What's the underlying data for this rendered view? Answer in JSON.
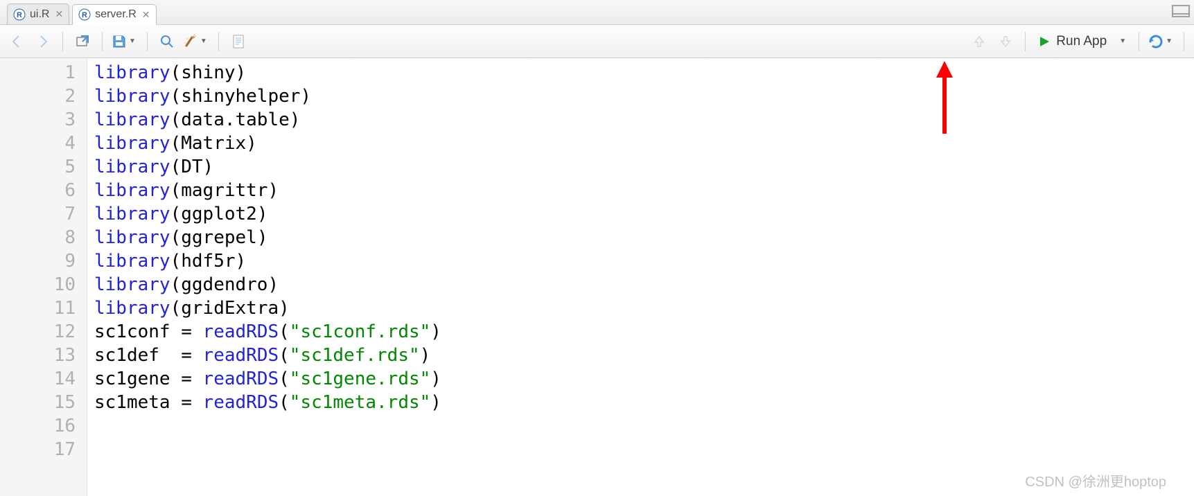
{
  "tabs": [
    {
      "label": "ui.R",
      "active": false
    },
    {
      "label": "server.R",
      "active": true
    }
  ],
  "toolbar": {
    "run_app_label": "Run App"
  },
  "code_lines": [
    {
      "n": "1",
      "tokens": [
        {
          "t": "library",
          "c": "call"
        },
        {
          "t": "(",
          "c": "punc"
        },
        {
          "t": "shiny",
          "c": "def"
        },
        {
          "t": ")",
          "c": "punc"
        }
      ]
    },
    {
      "n": "2",
      "tokens": [
        {
          "t": "library",
          "c": "call"
        },
        {
          "t": "(",
          "c": "punc"
        },
        {
          "t": "shinyhelper",
          "c": "def"
        },
        {
          "t": ")",
          "c": "punc"
        }
      ]
    },
    {
      "n": "3",
      "tokens": [
        {
          "t": "library",
          "c": "call"
        },
        {
          "t": "(",
          "c": "punc"
        },
        {
          "t": "data.table",
          "c": "def"
        },
        {
          "t": ")",
          "c": "punc"
        }
      ]
    },
    {
      "n": "4",
      "tokens": [
        {
          "t": "library",
          "c": "call"
        },
        {
          "t": "(",
          "c": "punc"
        },
        {
          "t": "Matrix",
          "c": "def"
        },
        {
          "t": ")",
          "c": "punc"
        }
      ]
    },
    {
      "n": "5",
      "tokens": [
        {
          "t": "library",
          "c": "call"
        },
        {
          "t": "(",
          "c": "punc"
        },
        {
          "t": "DT",
          "c": "def"
        },
        {
          "t": ")",
          "c": "punc"
        }
      ]
    },
    {
      "n": "6",
      "tokens": [
        {
          "t": "library",
          "c": "call"
        },
        {
          "t": "(",
          "c": "punc"
        },
        {
          "t": "magrittr",
          "c": "def"
        },
        {
          "t": ")",
          "c": "punc"
        }
      ]
    },
    {
      "n": "7",
      "tokens": [
        {
          "t": "library",
          "c": "call"
        },
        {
          "t": "(",
          "c": "punc"
        },
        {
          "t": "ggplot2",
          "c": "def"
        },
        {
          "t": ")",
          "c": "punc"
        }
      ]
    },
    {
      "n": "8",
      "tokens": [
        {
          "t": "library",
          "c": "call"
        },
        {
          "t": "(",
          "c": "punc"
        },
        {
          "t": "ggrepel",
          "c": "def"
        },
        {
          "t": ")",
          "c": "punc"
        }
      ]
    },
    {
      "n": "9",
      "tokens": [
        {
          "t": "library",
          "c": "call"
        },
        {
          "t": "(",
          "c": "punc"
        },
        {
          "t": "hdf5r",
          "c": "def"
        },
        {
          "t": ")",
          "c": "punc"
        }
      ]
    },
    {
      "n": "10",
      "tokens": [
        {
          "t": "library",
          "c": "call"
        },
        {
          "t": "(",
          "c": "punc"
        },
        {
          "t": "ggdendro",
          "c": "def"
        },
        {
          "t": ")",
          "c": "punc"
        }
      ]
    },
    {
      "n": "11",
      "tokens": [
        {
          "t": "library",
          "c": "call"
        },
        {
          "t": "(",
          "c": "punc"
        },
        {
          "t": "gridExtra",
          "c": "def"
        },
        {
          "t": ")",
          "c": "punc"
        }
      ]
    },
    {
      "n": "12",
      "tokens": [
        {
          "t": "sc1conf = ",
          "c": "def"
        },
        {
          "t": "readRDS",
          "c": "call"
        },
        {
          "t": "(",
          "c": "punc"
        },
        {
          "t": "\"sc1conf.rds\"",
          "c": "str"
        },
        {
          "t": ")",
          "c": "punc"
        }
      ]
    },
    {
      "n": "13",
      "tokens": [
        {
          "t": "sc1def  = ",
          "c": "def"
        },
        {
          "t": "readRDS",
          "c": "call"
        },
        {
          "t": "(",
          "c": "punc"
        },
        {
          "t": "\"sc1def.rds\"",
          "c": "str"
        },
        {
          "t": ")",
          "c": "punc"
        }
      ]
    },
    {
      "n": "14",
      "tokens": [
        {
          "t": "sc1gene = ",
          "c": "def"
        },
        {
          "t": "readRDS",
          "c": "call"
        },
        {
          "t": "(",
          "c": "punc"
        },
        {
          "t": "\"sc1gene.rds\"",
          "c": "str"
        },
        {
          "t": ")",
          "c": "punc"
        }
      ]
    },
    {
      "n": "15",
      "tokens": [
        {
          "t": "sc1meta = ",
          "c": "def"
        },
        {
          "t": "readRDS",
          "c": "call"
        },
        {
          "t": "(",
          "c": "punc"
        },
        {
          "t": "\"sc1meta.rds\"",
          "c": "str"
        },
        {
          "t": ")",
          "c": "punc"
        }
      ]
    },
    {
      "n": "16",
      "tokens": []
    },
    {
      "n": "17",
      "tokens": []
    }
  ],
  "watermark": "CSDN @徐洲更hoptop"
}
